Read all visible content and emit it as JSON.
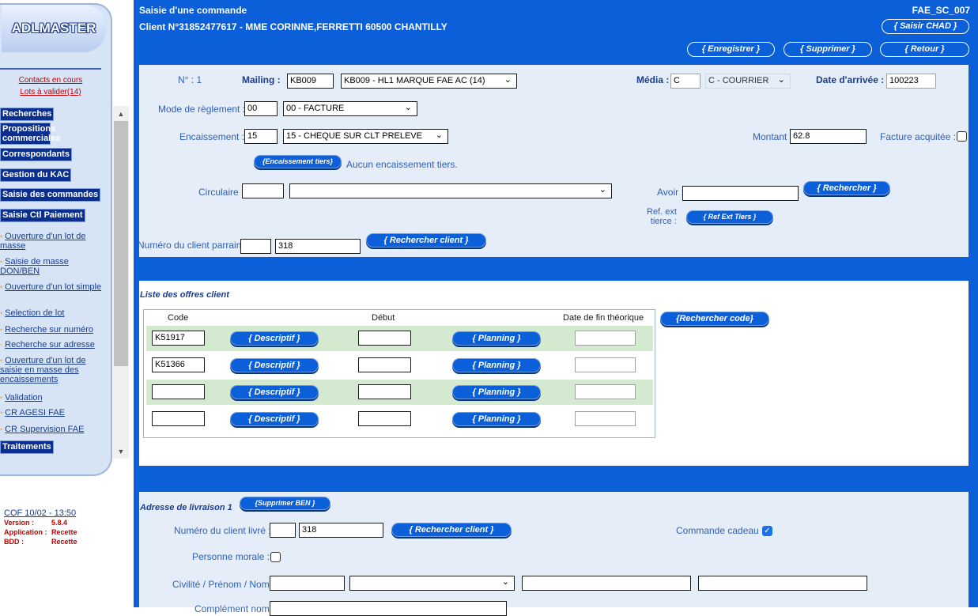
{
  "sidebar": {
    "logo": "ADLMASTER",
    "links_red": [
      "Contacts en cours",
      "Lots à valider(14)"
    ],
    "menu": [
      {
        "label": "Recherches"
      },
      {
        "label": "Propositions commerciales"
      },
      {
        "label": "Correspondants"
      },
      {
        "label": "Gestion du KAC"
      },
      {
        "label": "Saisie des commandes"
      },
      {
        "label": "Saisie Ctl Paiement"
      }
    ],
    "sub_items": [
      "Ouverture d'un lot de masse",
      "Saisie de masse DON/BEN",
      "Ouverture d'un lot simple",
      "Selection de lot",
      "Recherche sur numéro",
      "Recherche sur adresse",
      "Ouverture d'un lot de saisie en masse des encaissements",
      "Validation",
      "CR AGESI FAE",
      "CR Supervision FAE"
    ],
    "menu_last": "Traitements",
    "footer": {
      "date": "COF 10/02 - 13:50",
      "version_label": "Version :",
      "version": "5.8.4",
      "application_label": "Application :",
      "application": "Recette",
      "bdd_label": "BDD :",
      "bdd": "Recette"
    }
  },
  "header": {
    "title": "Saisie d'une commande",
    "client": "Client N°31852477617 - MME CORINNE,FERRETTI 60500 CHANTILLY",
    "screen_code": "FAE_SC_007",
    "btn_chad": "{ Saisir CHAD }",
    "btn_save": "{ Enregistrer }",
    "btn_delete": "{ Supprimer }",
    "btn_back": "{ Retour }"
  },
  "order": {
    "n_label": "N° : 1",
    "mailing_label": "Mailing :",
    "mailing_code": "KB009",
    "mailing_select": "KB009 - HL1 MARQUE FAE AC (14)",
    "media_label": "Média :",
    "media_code": "C",
    "media_select": "C - COURRIER",
    "arrival_label": "Date d'arrivée :",
    "arrival_value": "100223",
    "payment_mode_label": "Mode de règlement :",
    "payment_mode_code": "00",
    "payment_mode_select": "00 - FACTURE",
    "encaissement_label": "Encaissement :",
    "encaissement_code": "15",
    "encaissement_select": "15 - CHEQUE SUR CLT PRELEVE",
    "montant_label": "Montant :",
    "montant_value": "62.8",
    "facture_label": "Facture acquitée :",
    "btn_enc_tiers": "{Encaissement tiers}",
    "enc_tiers_text": "Aucun encaissement tiers.",
    "circulaire_label": "Circulaire :",
    "avoir_label": "Avoir :",
    "btn_rechercher": "{ Rechercher }",
    "ref_ext_label_1": "Ref. ext",
    "ref_ext_label_2": "tierce :",
    "btn_ref_ext": "{ Ref Ext Tiers }",
    "parrain_label": "Numéro du client parrain :",
    "parrain_value": "318",
    "btn_rechercher_client": "{ Rechercher client }"
  },
  "offers": {
    "title": "Liste des offres client",
    "col_code": "Code",
    "col_debut": "Début",
    "col_fin": "Date de fin théorique",
    "btn_rechercher_code": "{Rechercher code}",
    "btn_descriptif": "{ Descriptif }",
    "btn_planning": "{ Planning }",
    "rows": [
      {
        "code": "K51917"
      },
      {
        "code": "K51366"
      },
      {
        "code": ""
      },
      {
        "code": ""
      }
    ]
  },
  "livraison": {
    "title": "Adresse de livraison 1",
    "btn_supprimer_ben": "{Supprimer BEN }",
    "client_livre_label": "Numéro du client livré :",
    "client_livre_value": "318",
    "btn_rechercher_client": "{ Rechercher client }",
    "cadeau_label": "Commande cadeau :",
    "personne_morale_label": "Personne morale :",
    "civilite_label": "Civilité / Prénom / Nom :",
    "complement_label": "Complément nom :"
  }
}
